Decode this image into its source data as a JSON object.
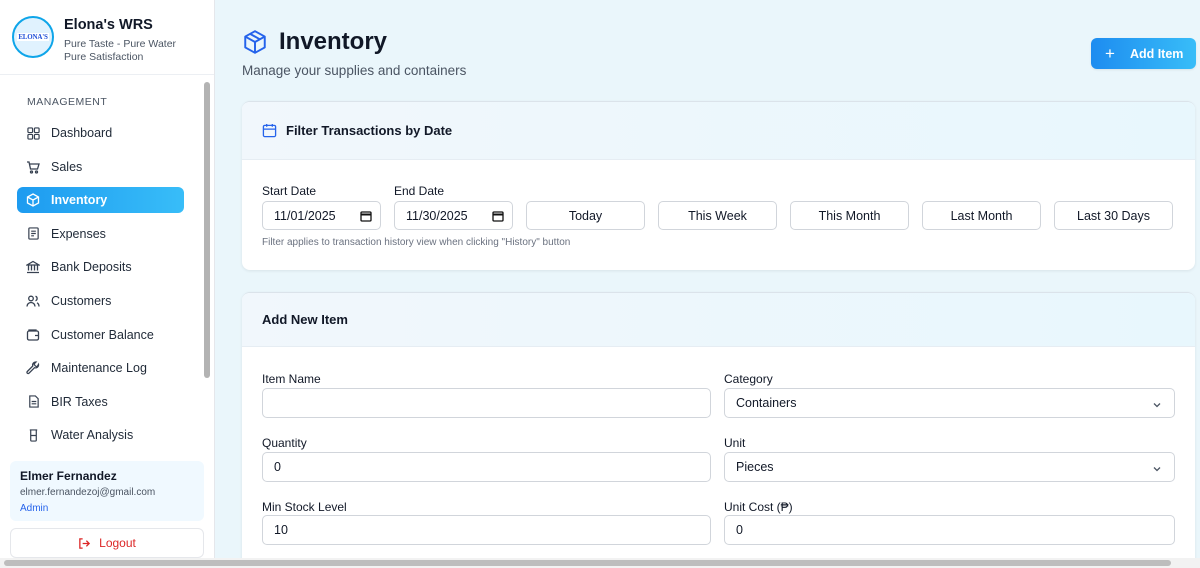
{
  "brand": {
    "name": "Elona's WRS",
    "tagline_1": "Pure Taste - Pure Water",
    "tagline_2": "Pure Satisfaction",
    "logo_text": "ELONA'S"
  },
  "sidebar": {
    "section_label": "MANAGEMENT",
    "items": [
      {
        "label": "Dashboard",
        "icon": "dashboard-icon"
      },
      {
        "label": "Sales",
        "icon": "cart-icon"
      },
      {
        "label": "Inventory",
        "icon": "box-icon",
        "active": true
      },
      {
        "label": "Expenses",
        "icon": "receipt-icon"
      },
      {
        "label": "Bank Deposits",
        "icon": "bank-icon"
      },
      {
        "label": "Customers",
        "icon": "users-icon"
      },
      {
        "label": "Customer Balance",
        "icon": "wallet-icon"
      },
      {
        "label": "Maintenance Log",
        "icon": "wrench-icon"
      },
      {
        "label": "BIR Taxes",
        "icon": "document-icon"
      },
      {
        "label": "Water Analysis",
        "icon": "beaker-icon"
      }
    ]
  },
  "user": {
    "name": "Elmer Fernandez",
    "email": "elmer.fernandezoj@gmail.com",
    "role": "Admin",
    "logout_label": "Logout"
  },
  "header": {
    "title": "Inventory",
    "subtitle": "Manage your supplies and containers",
    "add_button_label": "Add Item"
  },
  "filter": {
    "title": "Filter Transactions by Date",
    "start_label": "Start Date",
    "start_value": "11/01/2025",
    "end_label": "End Date",
    "end_value": "11/30/2025",
    "quick_buttons": [
      "Today",
      "This Week",
      "This Month",
      "Last Month",
      "Last 30 Days"
    ],
    "hint": "Filter applies to transaction history view when clicking \"History\" button"
  },
  "add_item": {
    "title": "Add New Item",
    "item_name_label": "Item Name",
    "item_name_value": "",
    "category_label": "Category",
    "category_value": "Containers",
    "quantity_label": "Quantity",
    "quantity_value": "0",
    "unit_label": "Unit",
    "unit_value": "Pieces",
    "min_stock_label": "Min Stock Level",
    "min_stock_value": "10",
    "unit_cost_label": "Unit Cost (₱)",
    "unit_cost_value": "0"
  },
  "colors": {
    "accent": "#1d9bf0",
    "logout": "#dc2626",
    "role": "#2563eb"
  }
}
